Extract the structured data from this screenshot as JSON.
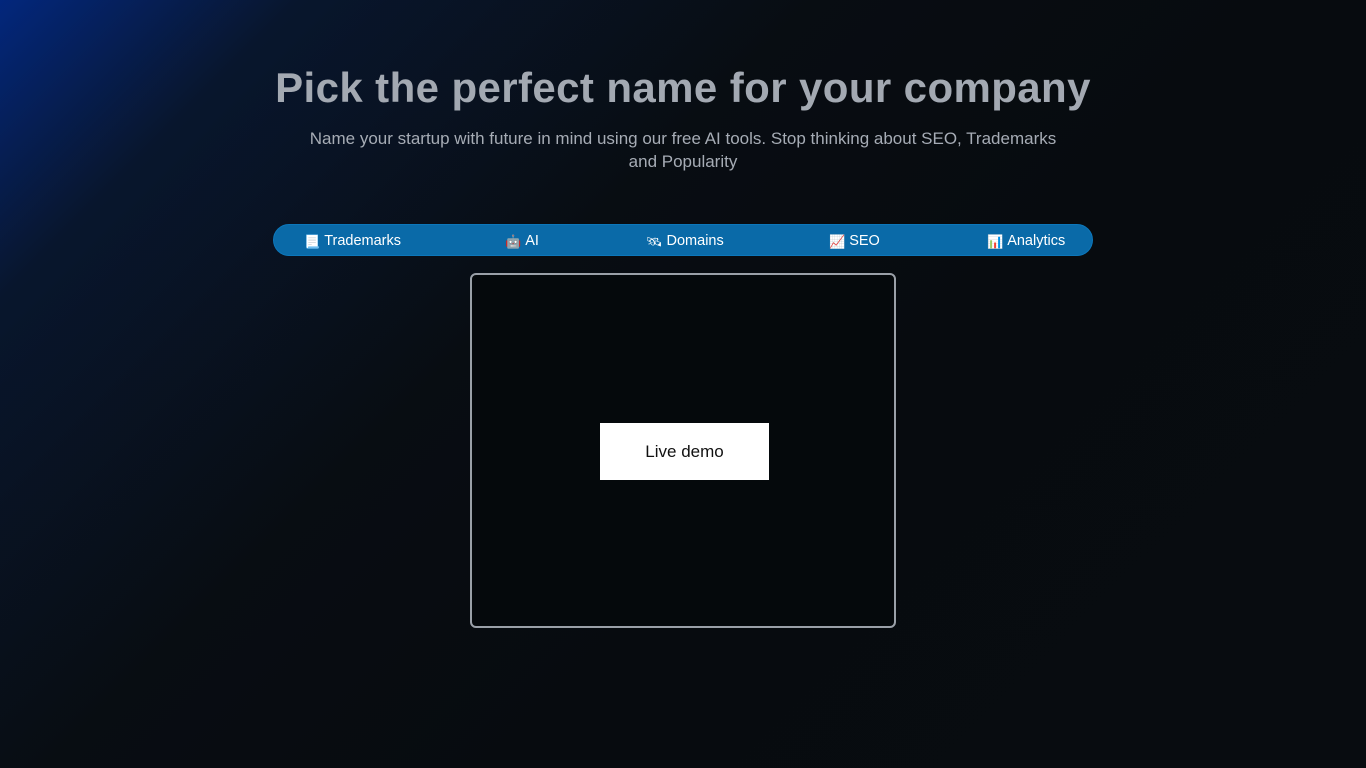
{
  "hero": {
    "title": "Pick the perfect name for your company",
    "subtitle": "Name your startup with future in mind using our free AI tools. Stop thinking about SEO, Trademarks and Popularity"
  },
  "features": {
    "bar_color": "#0a6aa8",
    "items": [
      {
        "label": "Trademarks",
        "icon": "notebook-icon",
        "glyph": "📃"
      },
      {
        "label": "AI",
        "icon": "robot-icon",
        "glyph": "🤖"
      },
      {
        "label": "Domains",
        "icon": "satellite-icon",
        "glyph": "🛰"
      },
      {
        "label": "SEO",
        "icon": "chart-increasing-icon",
        "glyph": "📈"
      },
      {
        "label": "Analytics",
        "icon": "bar-chart-icon",
        "glyph": "📊"
      }
    ]
  },
  "demo": {
    "button_label": "Live demo"
  },
  "colors": {
    "background": "#070b0f",
    "title": "#a3a9b2",
    "frame_border": "#9aa0a8"
  }
}
